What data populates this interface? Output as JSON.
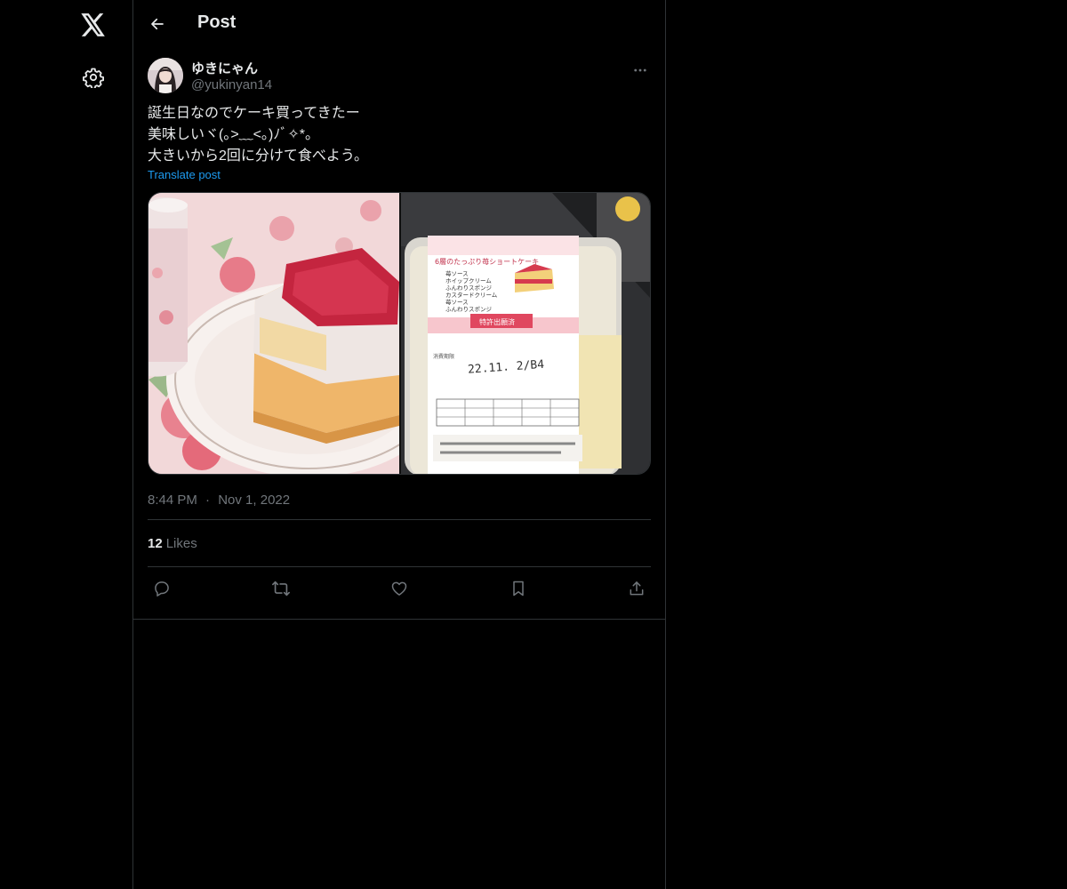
{
  "header": {
    "title": "Post",
    "back_icon": "arrow-left-icon"
  },
  "nav": {
    "logo_icon": "x-logo-icon",
    "settings_icon": "gear-icon"
  },
  "post": {
    "author": {
      "display_name": "ゆきにゃん",
      "handle": "@yukinyan14"
    },
    "more_icon": "more-horizontal-icon",
    "text_lines": [
      "誕生日なのでケーキ買ってきたー",
      "美味しいヾ(｡>﹏<｡)ﾉﾞ✧*。",
      "大きいから2回に分けて食べよう。"
    ],
    "translate_label": "Translate post",
    "images": [
      {
        "alt": "Slice of strawberry shortcake on a floral plate",
        "printed_text": []
      },
      {
        "alt": "Packaged shortcake with a label",
        "printed_text": [
          "6層のたっぷり苺ショートケーキ",
          "苺ソース",
          "ホイップクリーム",
          "ふんわりスポンジ",
          "カスタードクリーム",
          "苺ソース",
          "ふんわりスポンジ",
          "特許出願済",
          "消費期限",
          "22.11. 2/B4"
        ]
      }
    ],
    "time": "8:44 PM",
    "date": "Nov 1, 2022",
    "meta_separator": "·",
    "likes_count": "12",
    "likes_label": "Likes",
    "actions": [
      "reply-icon",
      "repost-icon",
      "like-icon",
      "bookmark-icon",
      "share-icon"
    ]
  },
  "colors": {
    "background": "#000000",
    "text": "#e7e9ea",
    "secondary": "#71767b",
    "link": "#1d9bf0",
    "border": "#2f3336"
  }
}
